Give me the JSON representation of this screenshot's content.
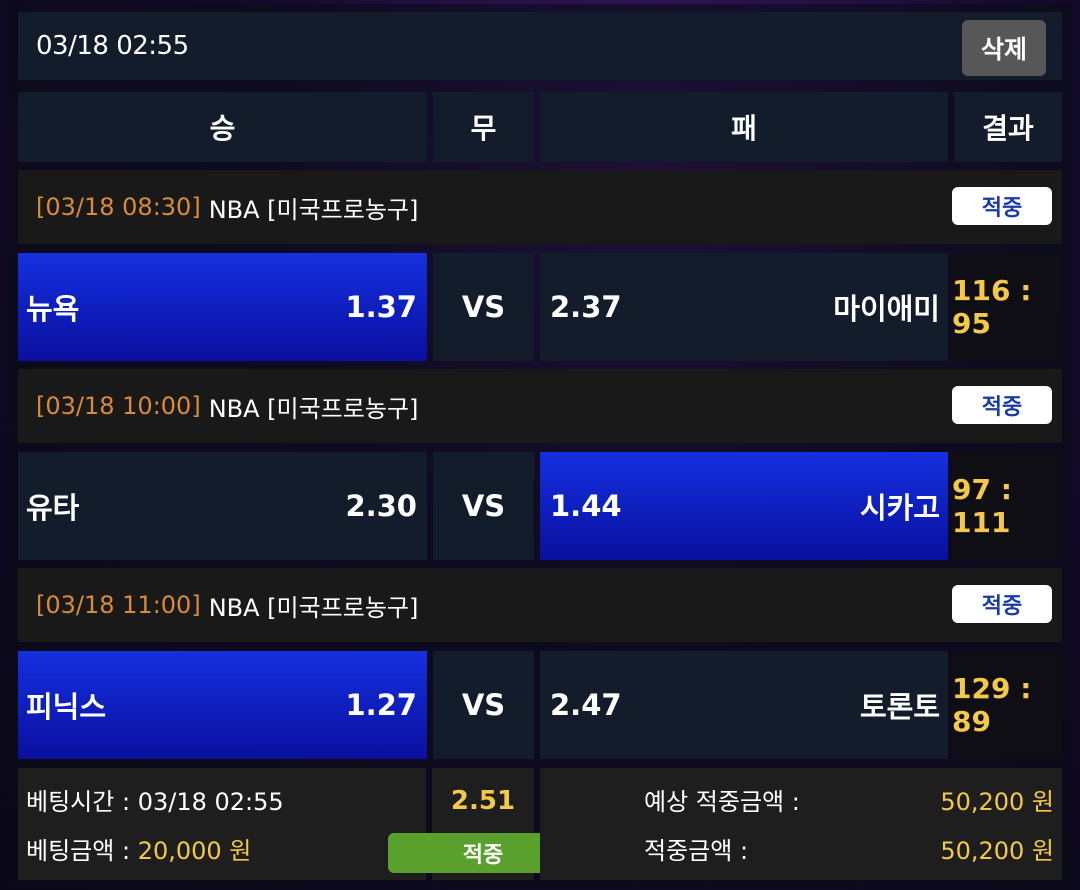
{
  "header": {
    "datetime": "03/18 02:55",
    "delete_label": "삭제"
  },
  "columns": {
    "win": "승",
    "draw": "무",
    "lose": "패",
    "result": "결과"
  },
  "games": [
    {
      "time": "[03/18 08:30]",
      "league": "NBA [미국프로농구]",
      "status": "적중",
      "home_team": "뉴욕",
      "home_odds": "1.37",
      "vs": "VS",
      "away_odds": "2.37",
      "away_team": "마이애미",
      "score": "116 : 95",
      "selected": "home"
    },
    {
      "time": "[03/18 10:00]",
      "league": "NBA [미국프로농구]",
      "status": "적중",
      "home_team": "유타",
      "home_odds": "2.30",
      "vs": "VS",
      "away_odds": "1.44",
      "away_team": "시카고",
      "score": "97 : 111",
      "selected": "away"
    },
    {
      "time": "[03/18 11:00]",
      "league": "NBA [미국프로농구]",
      "status": "적중",
      "home_team": "피닉스",
      "home_odds": "1.27",
      "vs": "VS",
      "away_odds": "2.47",
      "away_team": "토론토",
      "score": "129 : 89",
      "selected": "home"
    }
  ],
  "summary": {
    "bet_time_label": "베팅시간 :",
    "bet_time": "03/18 02:55",
    "bet_amount_label": "베팅금액 :",
    "bet_amount": "20,000 원",
    "total_odds": "2.51",
    "result_label": "적중",
    "expected_label": "예상 적중금액 :",
    "expected_amount": "50,200 원",
    "win_label": "적중금액 :",
    "win_amount": "50,200 원"
  },
  "colors": {
    "selected": "#1430e0",
    "score": "#f4c84a",
    "time": "#d98a3a",
    "hit_button": "#5aa02c"
  }
}
